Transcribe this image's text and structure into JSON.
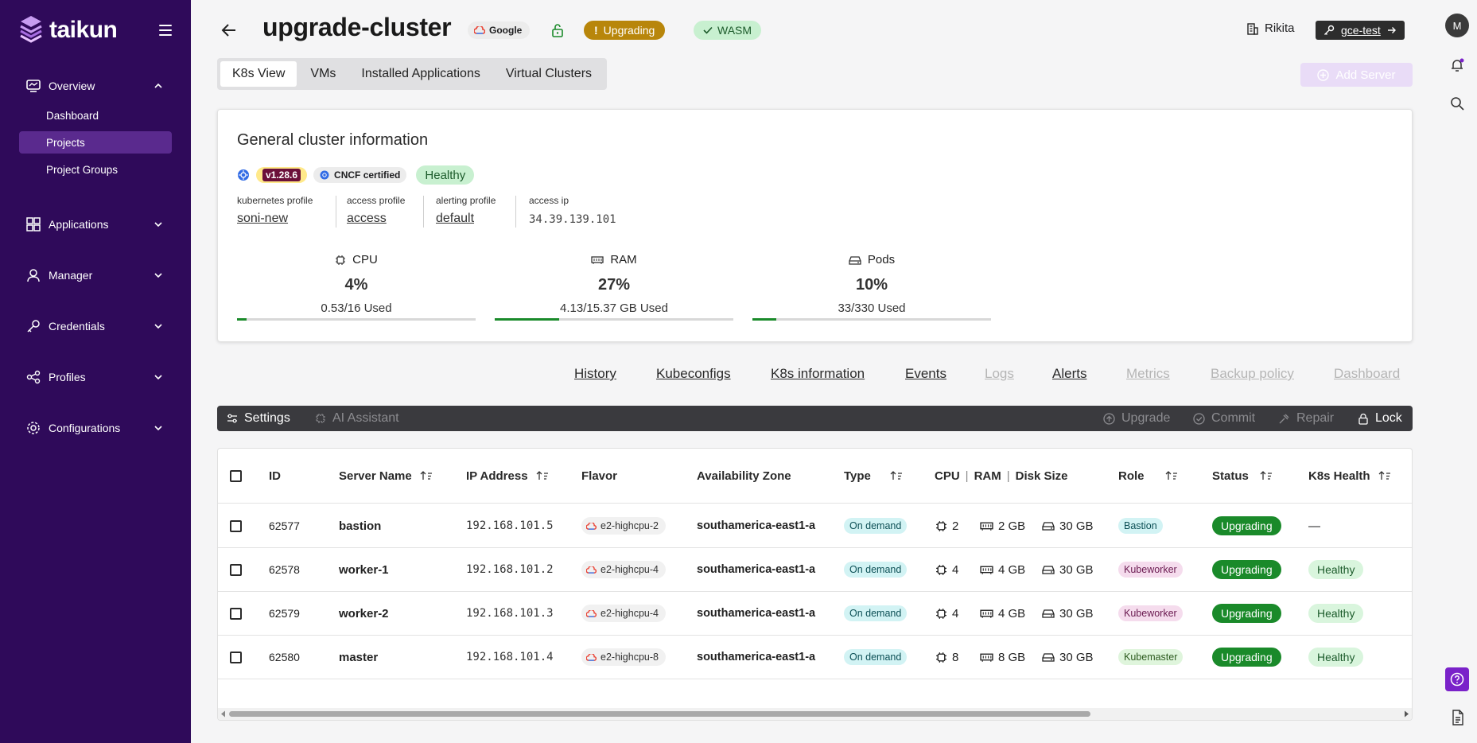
{
  "brand": {
    "name": "taikun"
  },
  "sidebar": {
    "groups": [
      {
        "label": "Overview",
        "icon": "overview-icon",
        "expanded": true
      },
      {
        "label": "Applications",
        "icon": "applications-icon",
        "expanded": false
      },
      {
        "label": "Manager",
        "icon": "user-icon",
        "expanded": false
      },
      {
        "label": "Credentials",
        "icon": "key-icon",
        "expanded": false
      },
      {
        "label": "Profiles",
        "icon": "share-icon",
        "expanded": false
      },
      {
        "label": "Configurations",
        "icon": "gear-icon",
        "expanded": false
      }
    ],
    "overview_items": [
      {
        "label": "Dashboard",
        "active": false
      },
      {
        "label": "Projects",
        "active": true
      },
      {
        "label": "Project Groups",
        "active": false
      }
    ]
  },
  "header": {
    "title": "upgrade-cluster",
    "cloud_chip": "Google",
    "status_chip": "Upgrading",
    "wasm_chip": "WASM",
    "organization": "Rikita",
    "project_button": "gce-test",
    "avatar_letter": "M"
  },
  "view_tabs": [
    {
      "label": "K8s View",
      "active": true
    },
    {
      "label": "VMs",
      "active": false
    },
    {
      "label": "Installed Applications",
      "active": false
    },
    {
      "label": "Virtual Clusters",
      "active": false
    }
  ],
  "add_server_label": "Add Server",
  "cluster_info": {
    "title": "General cluster information",
    "version": "v1.28.6",
    "cncf": "CNCF certified",
    "health": "Healthy",
    "profiles": [
      {
        "label": "kubernetes profile",
        "value": "soni-new"
      },
      {
        "label": "access profile",
        "value": "access"
      },
      {
        "label": "alerting profile",
        "value": "default"
      },
      {
        "label": "access ip",
        "value": "34.39.139.101"
      }
    ],
    "metrics": [
      {
        "name": "CPU",
        "percent": "4%",
        "used": "0.53/16 Used",
        "fraction": 0.04
      },
      {
        "name": "RAM",
        "percent": "27%",
        "used": "4.13/15.37 GB Used",
        "fraction": 0.27
      },
      {
        "name": "Pods",
        "percent": "10%",
        "used": "33/330 Used",
        "fraction": 0.1
      }
    ]
  },
  "links": [
    {
      "label": "History",
      "enabled": true
    },
    {
      "label": "Kubeconfigs",
      "enabled": true
    },
    {
      "label": "K8s information",
      "enabled": true
    },
    {
      "label": "Events",
      "enabled": true
    },
    {
      "label": "Logs",
      "enabled": false
    },
    {
      "label": "Alerts",
      "enabled": true
    },
    {
      "label": "Metrics",
      "enabled": false
    },
    {
      "label": "Backup policy",
      "enabled": false
    },
    {
      "label": "Dashboard",
      "enabled": false
    }
  ],
  "toolbar": {
    "settings": "Settings",
    "ai_assistant": "AI Assistant",
    "upgrade": "Upgrade",
    "commit": "Commit",
    "repair": "Repair",
    "lock": "Lock"
  },
  "table": {
    "headers": {
      "id": "ID",
      "server_name": "Server Name",
      "ip": "IP Address",
      "flavor": "Flavor",
      "zone": "Availability Zone",
      "type": "Type",
      "cpu": "CPU",
      "ram": "RAM",
      "disk": "Disk Size",
      "role": "Role",
      "status": "Status",
      "health": "K8s Health"
    },
    "rows": [
      {
        "id": "62577",
        "name": "bastion",
        "ip": "192.168.101.5",
        "flavor": "e2-highcpu-2",
        "zone": "southamerica-east1-a",
        "type": "On demand",
        "cpu": "2",
        "ram": "2 GB",
        "disk": "30 GB",
        "role": "Bastion",
        "status": "Upgrading",
        "health": "—"
      },
      {
        "id": "62578",
        "name": "worker-1",
        "ip": "192.168.101.2",
        "flavor": "e2-highcpu-4",
        "zone": "southamerica-east1-a",
        "type": "On demand",
        "cpu": "4",
        "ram": "4 GB",
        "disk": "30 GB",
        "role": "Kubeworker",
        "status": "Upgrading",
        "health": "Healthy"
      },
      {
        "id": "62579",
        "name": "worker-2",
        "ip": "192.168.101.3",
        "flavor": "e2-highcpu-4",
        "zone": "southamerica-east1-a",
        "type": "On demand",
        "cpu": "4",
        "ram": "4 GB",
        "disk": "30 GB",
        "role": "Kubeworker",
        "status": "Upgrading",
        "health": "Healthy"
      },
      {
        "id": "62580",
        "name": "master",
        "ip": "192.168.101.4",
        "flavor": "e2-highcpu-8",
        "zone": "southamerica-east1-a",
        "type": "On demand",
        "cpu": "8",
        "ram": "8 GB",
        "disk": "30 GB",
        "role": "Kubemaster",
        "status": "Upgrading",
        "health": "Healthy"
      }
    ]
  },
  "colors": {
    "sidebar_bg": "#2f0a5a",
    "sidebar_active": "#5a2a8e",
    "upgrading_chip": "#b8860b",
    "status_green": "#1a8a2a",
    "accent_purple": "#7a22c9"
  }
}
